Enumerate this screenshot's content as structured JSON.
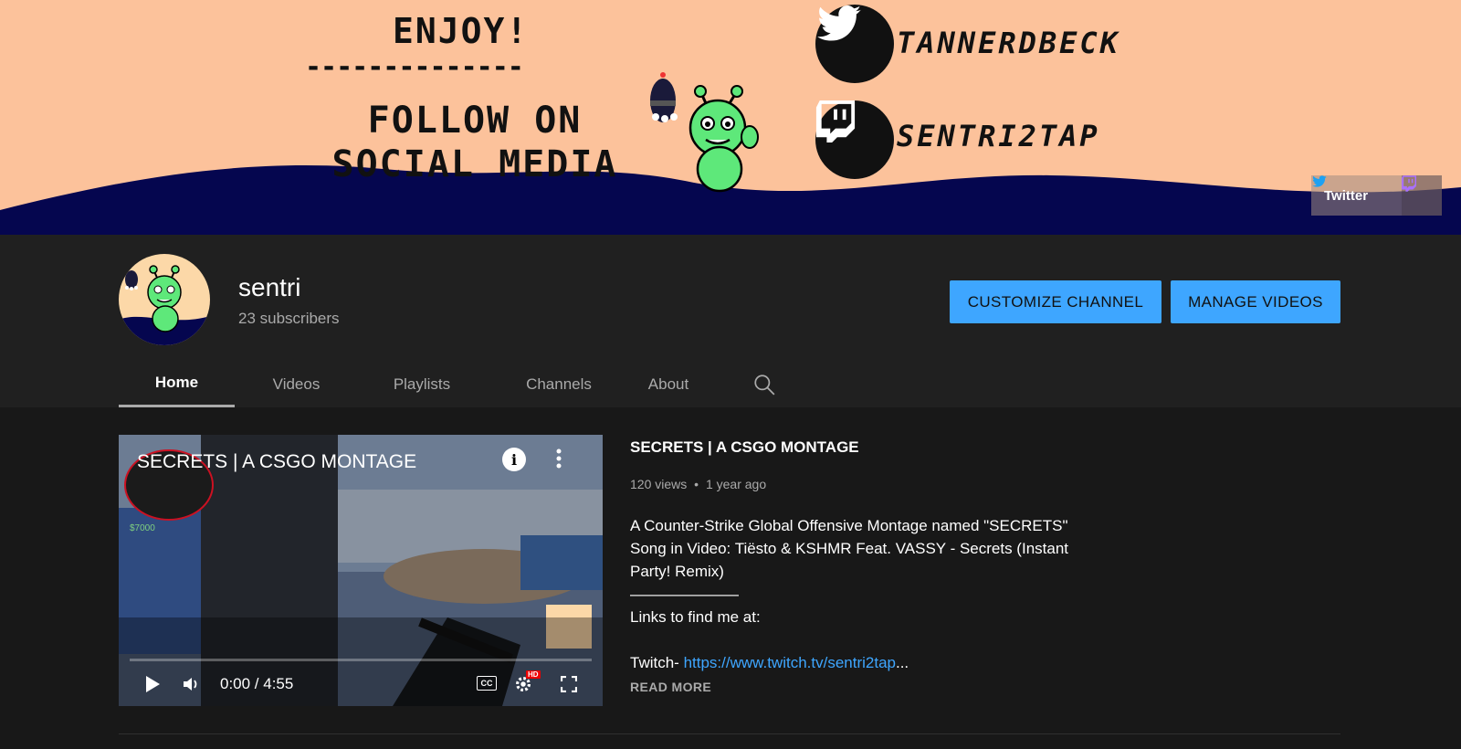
{
  "banner": {
    "enjoy": "ENJOY!",
    "dashes": "--------------",
    "follow_line1": "FOLLOW ON",
    "follow_line2": "SOCIAL MEDIA",
    "twitter_handle": "TANNERDBECK",
    "twitch_handle": "SENTRI2TAP",
    "link_label": "Twitter",
    "colors": {
      "background": "#fcc29b",
      "wave": "#05064f",
      "alien": "#5ee87a"
    }
  },
  "channel": {
    "name": "sentri",
    "subscribers": "23 subscribers",
    "customize_label": "CUSTOMIZE CHANNEL",
    "manage_label": "MANAGE VIDEOS",
    "accent": "#3ea6ff"
  },
  "tabs": [
    {
      "label": "Home",
      "active": true
    },
    {
      "label": "Videos"
    },
    {
      "label": "Playlists"
    },
    {
      "label": "Channels"
    },
    {
      "label": "About"
    }
  ],
  "featured": {
    "player_title": "SECRETS | A CSGO MONTAGE",
    "time": "0:00 / 4:55",
    "hud_money": "$7000",
    "title": "SECRETS | A CSGO MONTAGE",
    "views": "120 views",
    "separator": "•",
    "age": "1 year ago",
    "description": [
      "A Counter-Strike Global Offensive Montage named \"SECRETS\"",
      "Song in Video: Tiësto & KSHMR Feat. VASSY - Secrets (Instant",
      "Party! Remix)",
      "———————",
      "Links to find me at:",
      "",
      "Twitch- "
    ],
    "twitch_link": "https://www.twitch.tv/sentri2tap",
    "ellipsis": "...",
    "read_more": "READ MORE",
    "hd_badge": "HD",
    "cc_label": "CC"
  }
}
